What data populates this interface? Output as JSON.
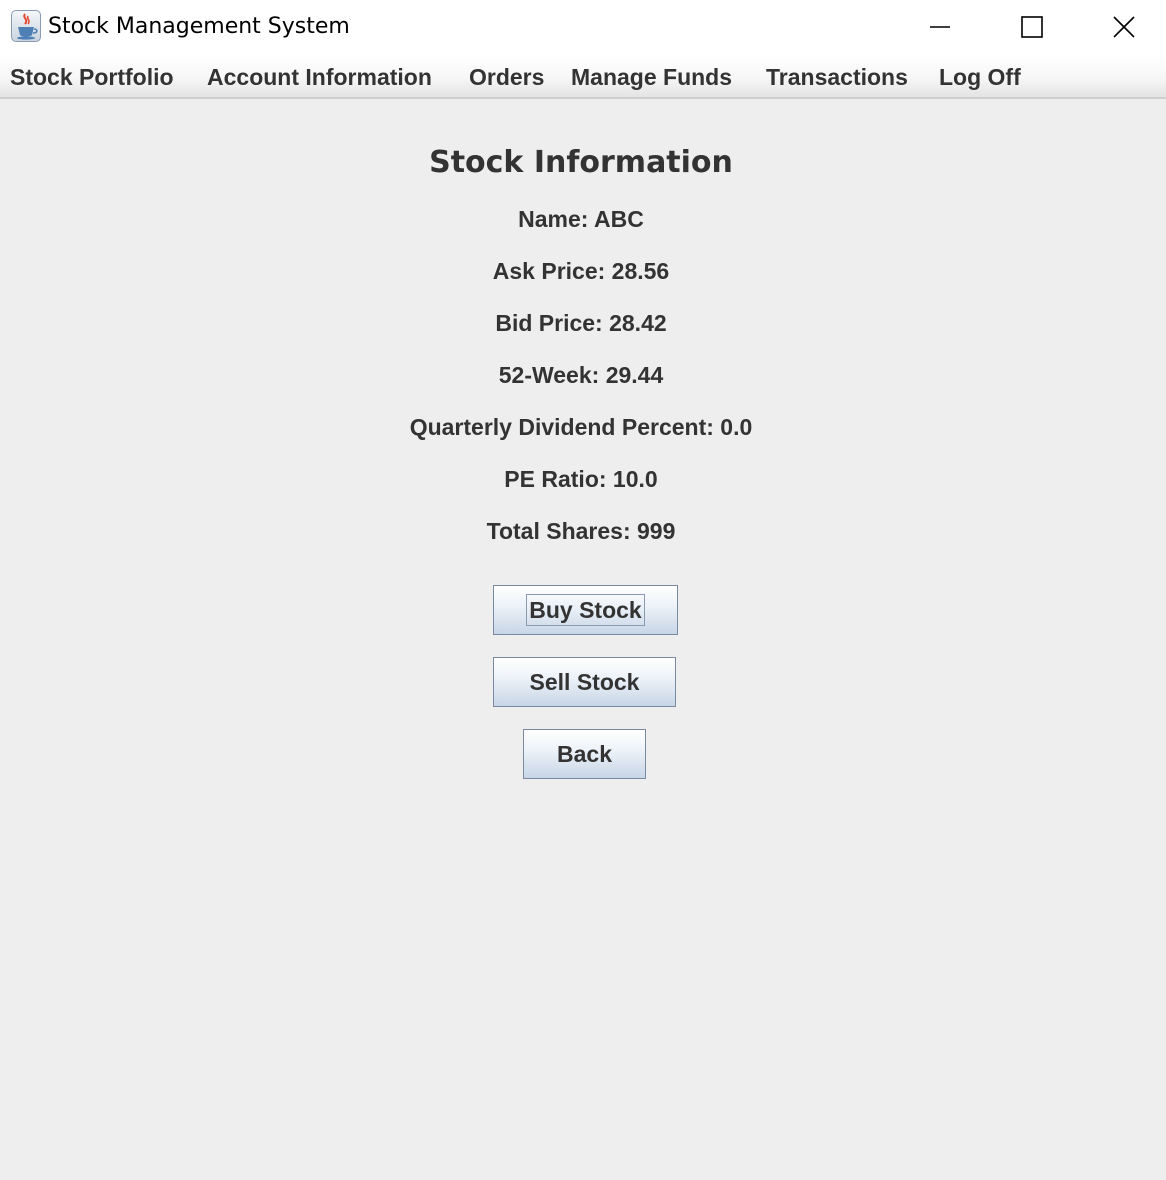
{
  "window": {
    "title": "Stock Management System",
    "icon": "java-cup-icon",
    "controls": [
      "minimize-icon",
      "maximize-icon",
      "close-icon"
    ]
  },
  "menu": {
    "items": [
      {
        "label": "Stock Portfolio"
      },
      {
        "label": "Account Information"
      },
      {
        "label": "Orders"
      },
      {
        "label": "Manage Funds"
      },
      {
        "label": "Transactions"
      },
      {
        "label": "Log Off"
      }
    ]
  },
  "stock": {
    "heading": "Stock Information",
    "name": "Name: ABC",
    "ask_price": "Ask Price: 28.56",
    "bid_price": "Bid Price: 28.42",
    "week52": "52-Week: 29.44",
    "dividend": "Quarterly Dividend Percent: 0.0",
    "pe_ratio": "PE Ratio: 10.0",
    "total_shares": "Total Shares: 999"
  },
  "actions": {
    "buy_label": "Buy Stock",
    "sell_label": "Sell Stock",
    "back_label": "Back"
  },
  "colors": {
    "background": "#eeeeee",
    "text": "#333333",
    "button_border": "#7a8aa0"
  }
}
